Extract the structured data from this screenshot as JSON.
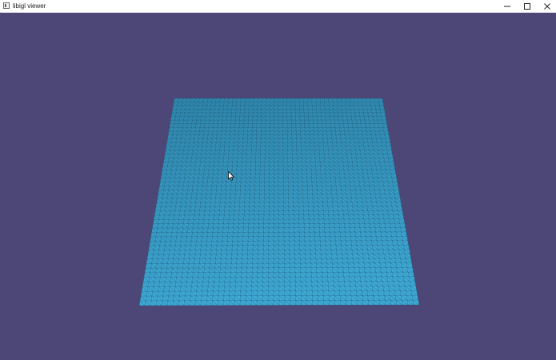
{
  "window": {
    "title": "libigl viewer",
    "app_icon": "window-app-icon",
    "controls": {
      "minimize_icon": "minimize-icon",
      "maximize_icon": "maximize-icon",
      "close_icon": "close-icon"
    }
  },
  "viewport": {
    "background_color": "#4c4777",
    "mesh": {
      "name": "triangulated-plane-mesh",
      "face_color": "#3a9fc9",
      "edge_color": "#1d4a66",
      "grid_divisions": 50
    },
    "cursor_icon": "mouse-pointer-icon"
  }
}
